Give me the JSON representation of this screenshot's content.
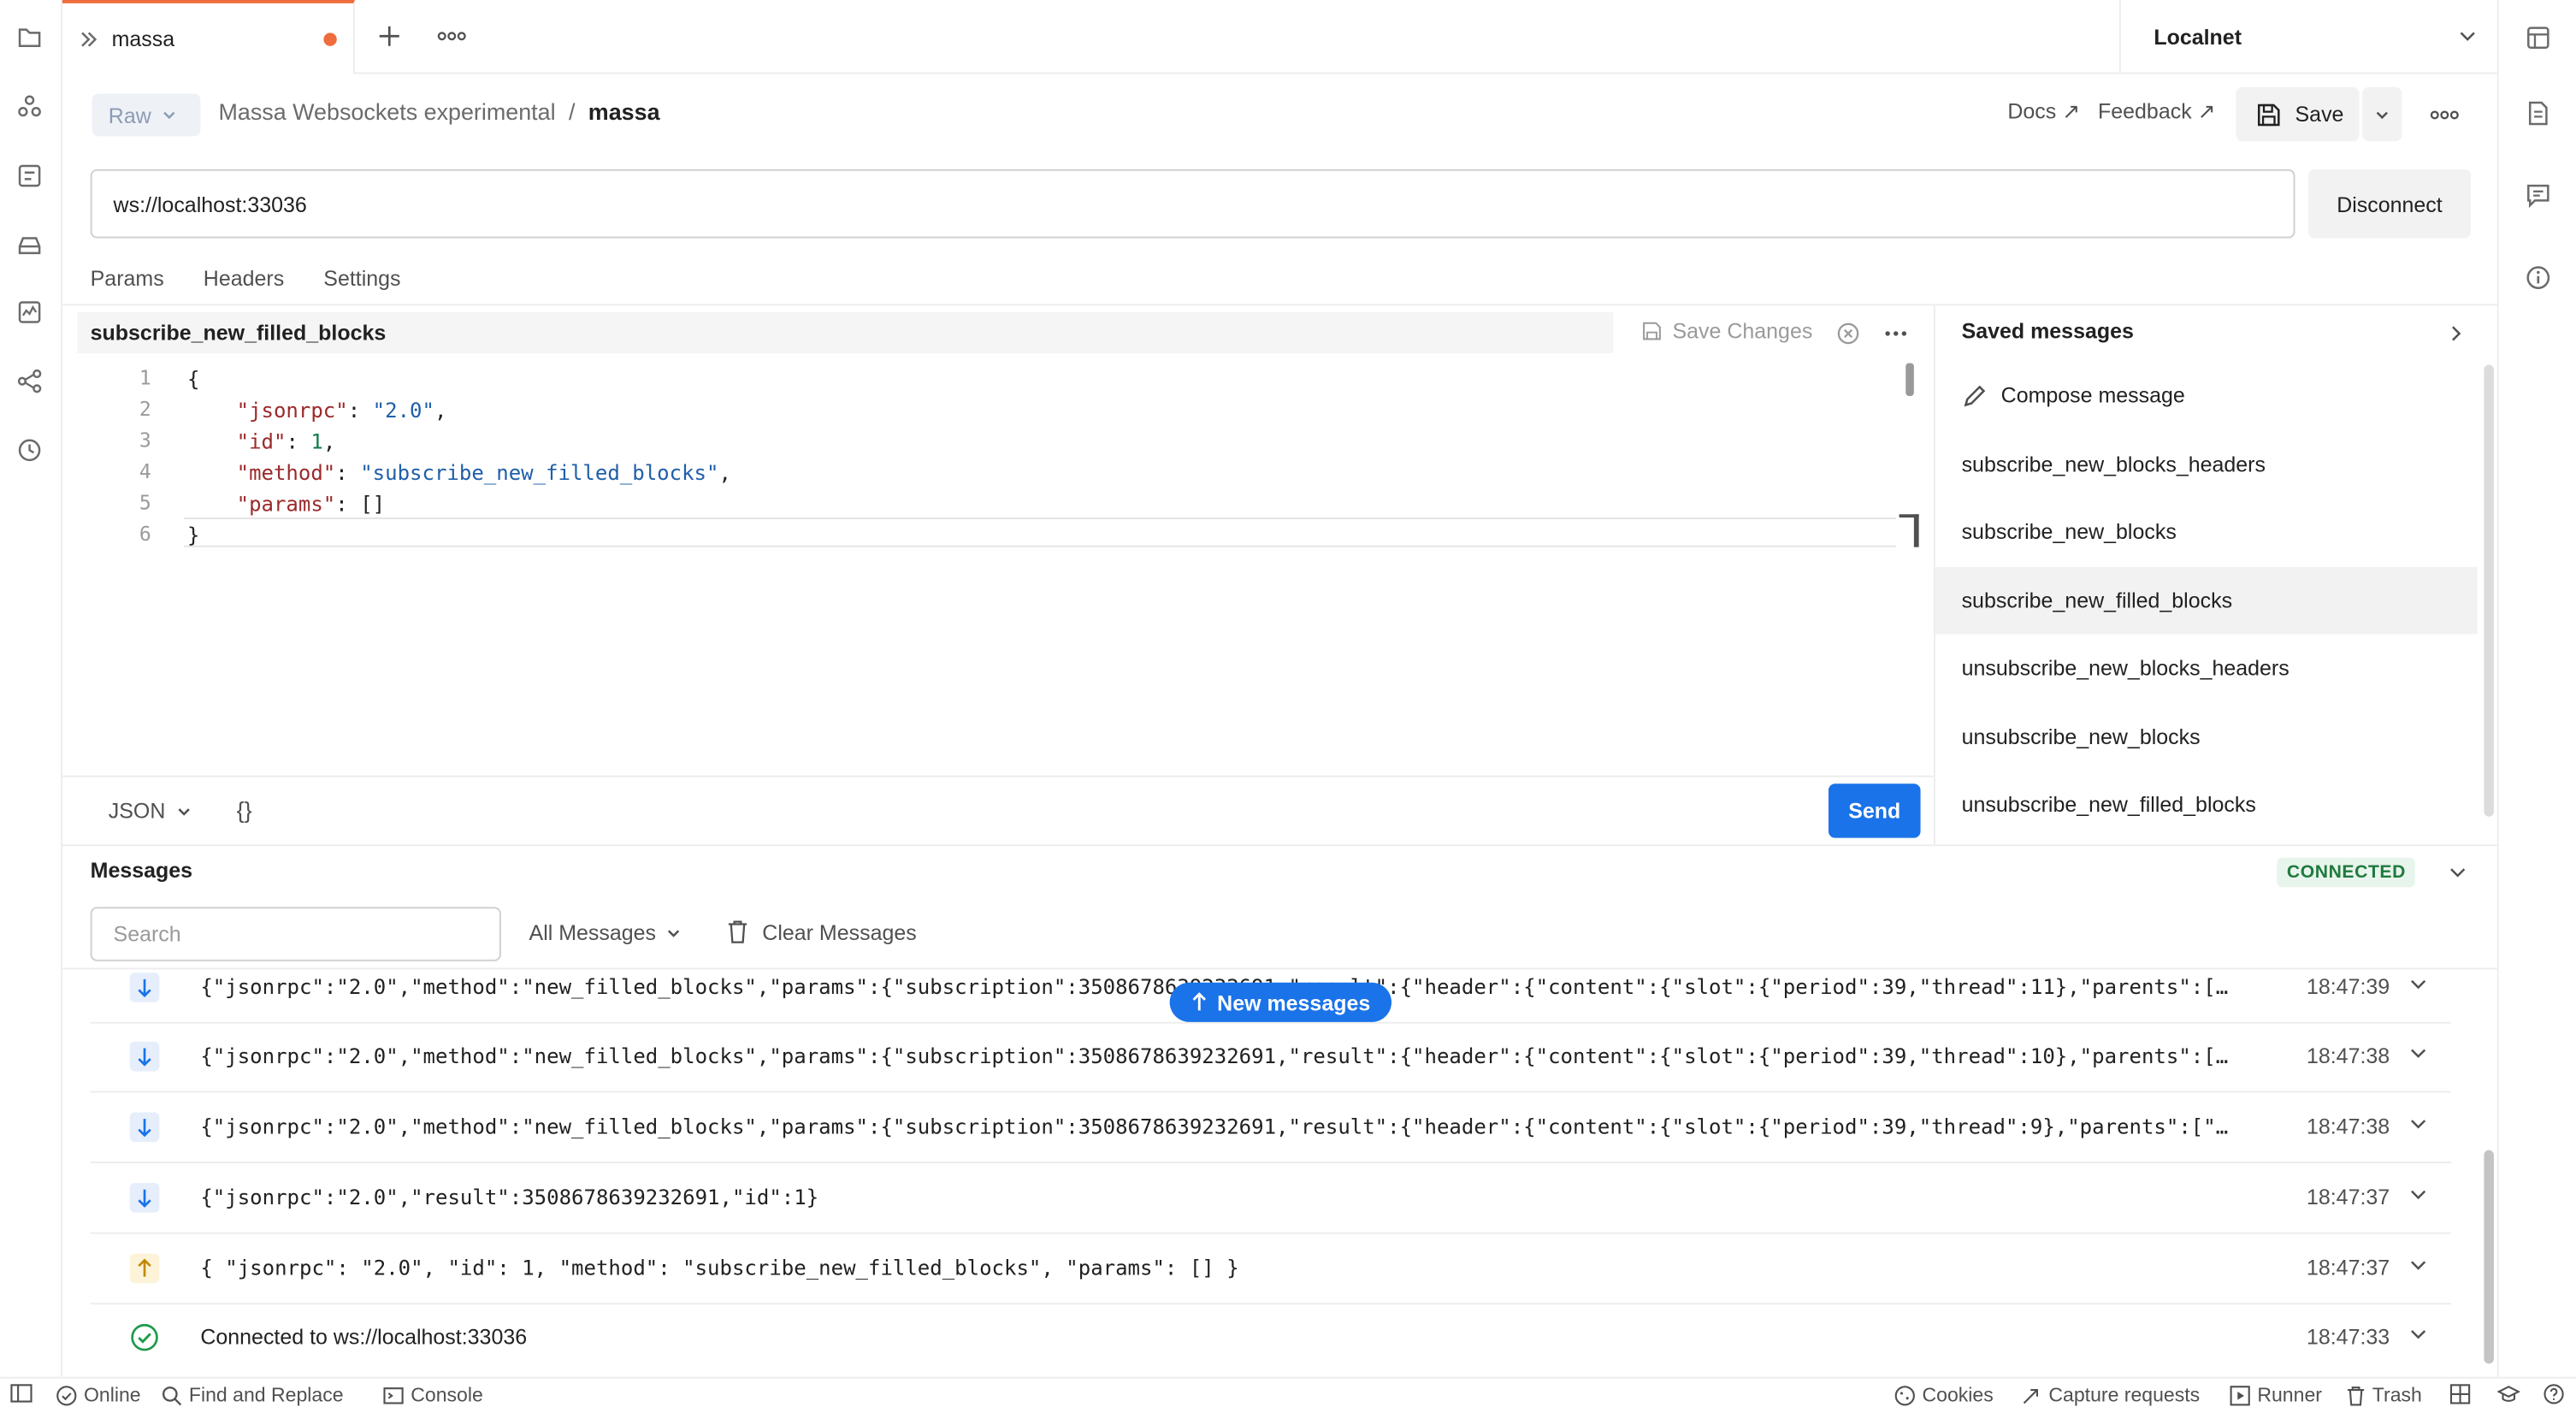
{
  "tab": {
    "title": "massa"
  },
  "environment": {
    "name": "Localnet"
  },
  "header": {
    "mode": "Raw",
    "breadcrumb_collection": "Massa Websockets experimental",
    "breadcrumb_separator": "/",
    "breadcrumb_request": "massa",
    "docs_label": "Docs ↗",
    "feedback_label": "Feedback ↗",
    "save_label": "Save"
  },
  "connection": {
    "url": "ws://localhost:33036",
    "disconnect_label": "Disconnect"
  },
  "subtabs": [
    "Params",
    "Headers",
    "Settings"
  ],
  "editor": {
    "message_name": "subscribe_new_filled_blocks",
    "save_changes_label": "Save Changes",
    "language": "JSON",
    "format_label": "{}",
    "send_label": "Send",
    "line_numbers": [
      "1",
      "2",
      "3",
      "4",
      "5",
      "6"
    ],
    "lines": [
      {
        "key": "",
        "val": "{"
      },
      {
        "key": "\"jsonrpc\"",
        "sep": ": ",
        "val": "\"2.0\"",
        "tail": ","
      },
      {
        "key": "\"id\"",
        "sep": ": ",
        "val": "1",
        "tail": ","
      },
      {
        "key": "\"method\"",
        "sep": ": ",
        "val": "\"subscribe_new_filled_blocks\"",
        "tail": ","
      },
      {
        "key": "\"params\"",
        "sep": ": ",
        "val": "[]",
        "tail": ""
      },
      {
        "key": "",
        "val": "}"
      }
    ]
  },
  "saved_messages": {
    "title": "Saved messages",
    "compose_label": "Compose message",
    "items": [
      "subscribe_new_blocks_headers",
      "subscribe_new_blocks",
      "subscribe_new_filled_blocks",
      "unsubscribe_new_blocks_headers",
      "unsubscribe_new_blocks",
      "unsubscribe_new_filled_blocks"
    ]
  },
  "messages": {
    "title": "Messages",
    "status": "CONNECTED",
    "search_placeholder": "Search",
    "filter_label": "All Messages",
    "clear_label": "Clear Messages",
    "new_messages_label": "New messages",
    "rows": [
      {
        "dir": "in",
        "text": "{\"jsonrpc\":\"2.0\",\"method\":\"new_filled_blocks\",\"params\":{\"subscription\":3508678639232691,\"result\":{\"header\":{\"content\":{\"slot\":{\"period\":39,\"thread\":11},\"parents\":[…",
        "time": "18:47:39"
      },
      {
        "dir": "in",
        "text": "{\"jsonrpc\":\"2.0\",\"method\":\"new_filled_blocks\",\"params\":{\"subscription\":3508678639232691,\"result\":{\"header\":{\"content\":{\"slot\":{\"period\":39,\"thread\":10},\"parents\":[…",
        "time": "18:47:38"
      },
      {
        "dir": "in",
        "text": "{\"jsonrpc\":\"2.0\",\"method\":\"new_filled_blocks\",\"params\":{\"subscription\":3508678639232691,\"result\":{\"header\":{\"content\":{\"slot\":{\"period\":39,\"thread\":9},\"parents\":[\"…",
        "time": "18:47:38"
      },
      {
        "dir": "in",
        "text": "{\"jsonrpc\":\"2.0\",\"result\":3508678639232691,\"id\":1}",
        "time": "18:47:37"
      },
      {
        "dir": "out",
        "text": "{ \"jsonrpc\": \"2.0\", \"id\": 1, \"method\": \"subscribe_new_filled_blocks\", \"params\": [] }",
        "time": "18:47:37"
      },
      {
        "dir": "info",
        "text": "Connected to ws://localhost:33036",
        "time": "18:47:33"
      }
    ]
  },
  "statusbar": {
    "online": "Online",
    "find_replace": "Find and Replace",
    "console": "Console",
    "cookies": "Cookies",
    "capture": "Capture requests",
    "runner": "Runner",
    "trash": "Trash"
  },
  "colors": {
    "accent": "#1a73e8",
    "tab_indicator": "#ef6c3c",
    "connected_text": "#1f7a3e",
    "connected_bg": "#e8f5ec"
  }
}
